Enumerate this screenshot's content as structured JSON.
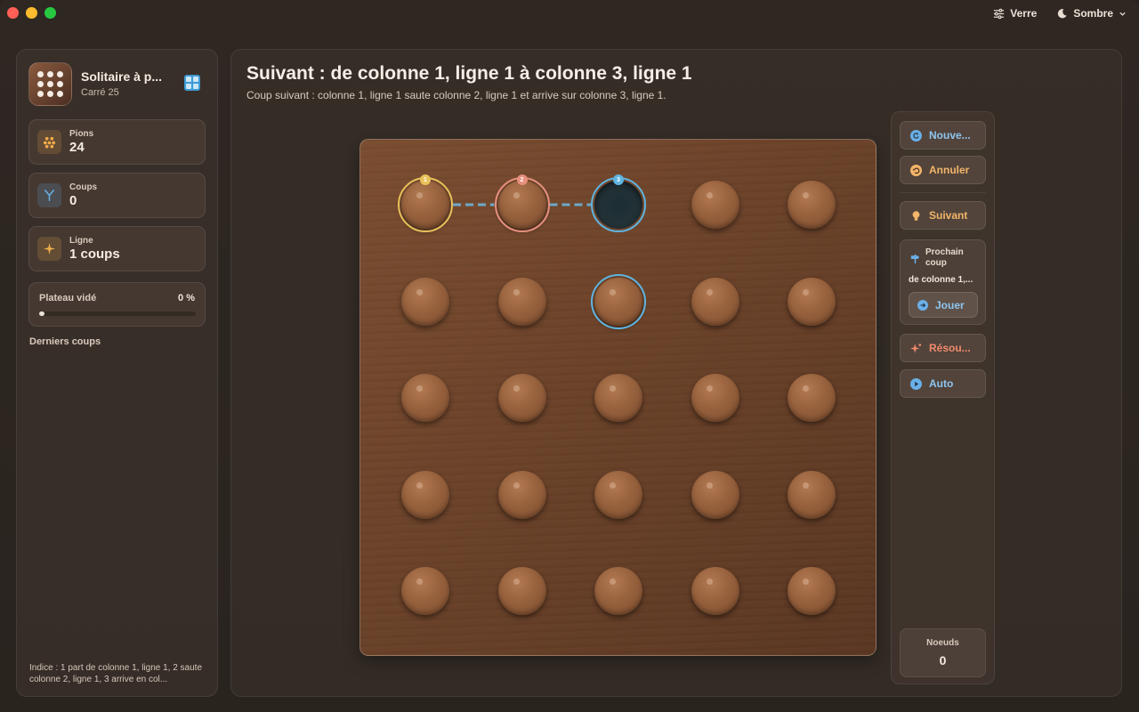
{
  "window": {
    "top_controls": [
      {
        "label": "Verre",
        "icon": "sliders-icon"
      },
      {
        "label": "Sombre",
        "icon": "moon-icon"
      }
    ]
  },
  "sidebar": {
    "app_title": "Solitaire à p...",
    "app_subtitle": "Carré 25",
    "stats": [
      {
        "label": "Pions",
        "value": "24",
        "icon": "pegs-icon",
        "color": "#f0a949"
      },
      {
        "label": "Coups",
        "value": "0",
        "icon": "branch-icon",
        "color": "#6ab2e6"
      },
      {
        "label": "Ligne",
        "value": "1 coups",
        "icon": "sparkle-icon",
        "color": "#f0b04a"
      }
    ],
    "progress": {
      "label": "Plateau vidé",
      "value_text": "0 %",
      "fraction": 0
    },
    "recent_title": "Derniers coups",
    "hint": "Indice : 1 part de colonne 1, ligne 1, 2 saute colonne 2, ligne 1, 3 arrive en col..."
  },
  "main": {
    "title": "Suivant : de colonne 1, ligne 1 à colonne 3, ligne 1",
    "subtitle": "Coup suivant : colonne 1, ligne 1 saute colonne 2, ligne 1 et arrive sur colonne 3, ligne 1."
  },
  "board": {
    "rows": 5,
    "cols": 5,
    "empty": [
      [
        1,
        3
      ]
    ],
    "highlight_cells": [
      {
        "col": 1,
        "row": 1,
        "badge": "1",
        "color": "#e8c15a"
      },
      {
        "col": 2,
        "row": 1,
        "badge": "2",
        "color": "#e88f7e"
      },
      {
        "col": 3,
        "row": 1,
        "badge": "3",
        "color": "#5fb4e0"
      },
      {
        "col": 3,
        "row": 2,
        "badge": "",
        "color": "#5fb4e0"
      }
    ],
    "path_color": "#6da9c9"
  },
  "controls": {
    "buttons": [
      {
        "label": "Nouve...",
        "icon": "refresh-icon",
        "color": "#8ec5ef"
      },
      {
        "label": "Annuler",
        "icon": "undo-icon",
        "color": "#f2b56a"
      },
      {
        "label": "Suivant",
        "icon": "lightbulb-icon",
        "color": "#f2b56a"
      },
      {
        "label": "Résou...",
        "icon": "sparkle-icon",
        "color": "#f08a6c"
      },
      {
        "label": "Auto",
        "icon": "play-icon",
        "color": "#8ec5ef"
      }
    ],
    "next_card": {
      "title": "Prochain coup",
      "move": "de colonne 1,...",
      "play_label": "Jouer"
    },
    "nodes": {
      "label": "Noeuds",
      "value": "0"
    }
  }
}
